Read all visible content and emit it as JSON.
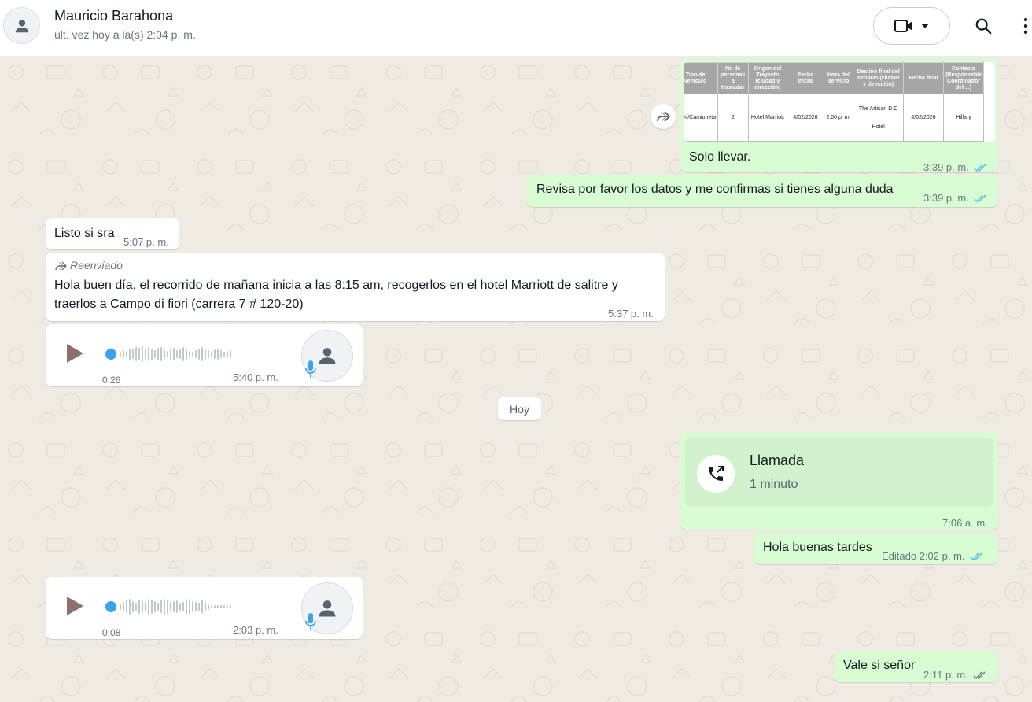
{
  "header": {
    "contact_name": "Mauricio Barahona",
    "contact_status": "últ. vez hoy a la(s) 2:04 p. m.",
    "icons": [
      "avatar-person-icon",
      "video-call-icon",
      "dropdown-caret-icon",
      "search-icon",
      "menu-dots-icon"
    ]
  },
  "messages": {
    "m1": {
      "table": {
        "headers": [
          "Tipo de vehículo",
          "No de personas a trasladar",
          "Origen del Trayecto (ciudad y dirección)",
          "Fecha inicial",
          "Hora del servicio",
          "Destino final del servicio (ciudad y dirección)",
          "Fecha final",
          "Contacto (Responsable Coordinador del ...)"
        ],
        "row": [
          "Móvil/Camioneta",
          "2",
          "Hotel Marriott",
          "4/02/2026",
          "2:00 p. m.",
          "The Artisan D.C Hotel",
          "4/02/2026",
          "Hillary"
        ]
      },
      "caption": "Solo llevar.",
      "time": "3:39 p. m."
    },
    "m2": {
      "text": "Revisa por favor los datos y me confirmas si tienes alguna duda",
      "time": "3:39 p. m."
    },
    "m3": {
      "text": "Listo si sra",
      "time": "5:07 p. m."
    },
    "m4": {
      "forwarded_label": "Reenviado",
      "line1": "Hola buen día, el recorrido de mañana inicia a las 8:15 am, recogerlos en el hotel Marriott de salitre y",
      "line2": "traerlos a Campo di fiori (carrera 7 # 120-20)",
      "time": "5:37 p. m."
    },
    "m5": {
      "duration": "0:26",
      "time": "5:40 p. m."
    },
    "date_separator": "Hoy",
    "m6": {
      "call_title": "Llamada",
      "call_subtitle": "1 minuto",
      "time": "7:06 a. m."
    },
    "m7": {
      "text": "Hola buenas tardes",
      "edited_label": "Editado",
      "time": "2:02 p. m."
    },
    "m8": {
      "duration": "0:08",
      "time": "2:03 p. m."
    },
    "m9": {
      "text": "Vale si señor",
      "time": "2:11 p. m."
    }
  },
  "colors": {
    "outgoing_bubble": "#d9fdd3",
    "incoming_bubble": "#ffffff",
    "chat_background": "#efeae2",
    "read_ticks": "#53bdeb",
    "delivered_ticks": "#667781"
  }
}
